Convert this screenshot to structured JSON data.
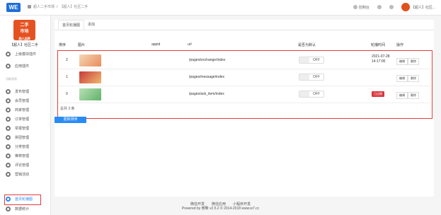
{
  "topbar": {
    "logo": "WE",
    "breadcrumb": [
      "超人二手市场",
      "/",
      "【超人】社区二手"
    ],
    "right": {
      "console": "控制台",
      "account": "【超人】社区..."
    }
  },
  "sidebar": {
    "shop_logo": "二手\n市场\n超人品牌",
    "shop_name": "【超人】社区二手",
    "top_items": [
      {
        "label": "上级模块插件"
      },
      {
        "label": "应用插件"
      }
    ],
    "section": "功能导航",
    "items": [
      {
        "label": "发布管理"
      },
      {
        "label": "会员管理"
      },
      {
        "label": "商家管理"
      },
      {
        "label": "订单管理"
      },
      {
        "label": "举报管理"
      },
      {
        "label": "拼团管理"
      },
      {
        "label": "分类管理"
      },
      {
        "label": "推荐管理"
      },
      {
        "label": "评论管理"
      },
      {
        "label": "营销活动"
      },
      {
        "label": "首页轮播图"
      },
      {
        "label": "数据统计"
      }
    ]
  },
  "tabs": [
    "首页轮播图",
    "添加"
  ],
  "table": {
    "headers": [
      "排序",
      "图片",
      "appid",
      "url",
      "是否为默认",
      "轮播时间",
      "操作"
    ],
    "rows": [
      {
        "order": "2",
        "url": "/pages/exchange/index",
        "toggle": "OFF",
        "time1": "2021-07-28",
        "time2": "14:17:00",
        "badge": "",
        "btn_edit": "编辑",
        "btn_delete": "删除"
      },
      {
        "order": "1",
        "url": "/pages/message/index",
        "toggle": "OFF",
        "time1": "",
        "time2": "",
        "badge": "",
        "btn_edit": "编辑",
        "btn_delete": "删除"
      },
      {
        "order": "0",
        "url": "/pages/ask_item/index",
        "toggle": "OFF",
        "time1": "",
        "time2": "",
        "badge": "已过期",
        "btn_edit": "编辑",
        "btn_delete": "删除"
      }
    ],
    "total": "总共 3 条"
  },
  "update_button": "更新排序",
  "footer": {
    "links": [
      "微信开发",
      "微信应用",
      "小程序开发"
    ],
    "powered": "Powered by 微擎 v2.5.2 © 2014-2018 www.w7.cc"
  },
  "colors": {
    "accent": "#2a8bf5",
    "highlight": "#e43c3c",
    "brand": "#e55222"
  }
}
